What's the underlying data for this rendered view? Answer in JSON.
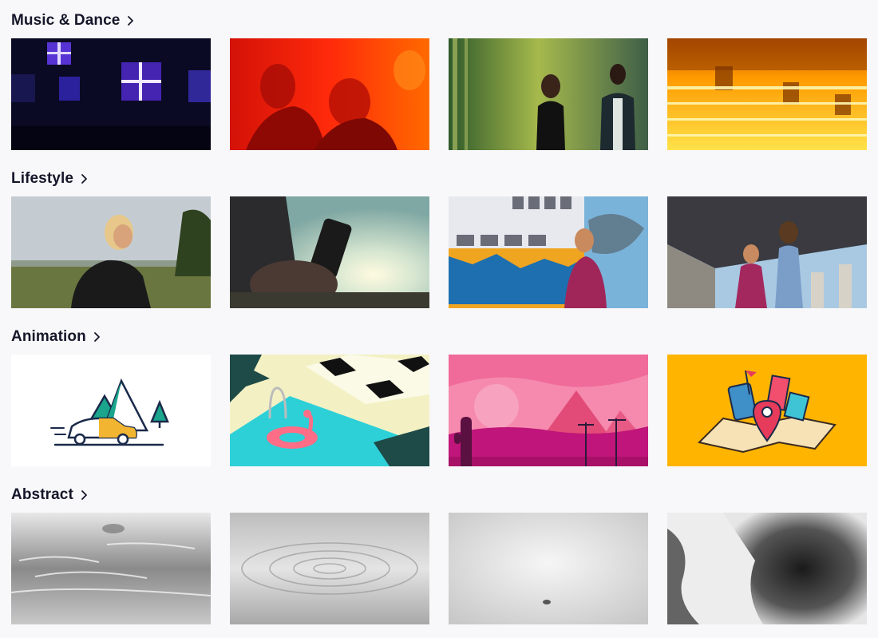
{
  "categories": [
    {
      "id": "music-dance",
      "title": "Music & Dance",
      "thumbnails": [
        {
          "name": "concert-lights-video",
          "palette": [
            "#0a0820",
            "#7a4cff"
          ]
        },
        {
          "name": "red-party-crowd-video",
          "palette": [
            "#e3190a",
            "#ff7a00"
          ]
        },
        {
          "name": "green-couple-dancing-video",
          "palette": [
            "#3a6a2e",
            "#b9c94a"
          ]
        },
        {
          "name": "stage-bulbs-video",
          "palette": [
            "#ff8a00",
            "#ffd200"
          ]
        }
      ]
    },
    {
      "id": "lifestyle",
      "title": "Lifestyle",
      "thumbnails": [
        {
          "name": "woman-phone-hillside-video",
          "palette": [
            "#b9c3c9",
            "#5b6a3a"
          ]
        },
        {
          "name": "phone-sunset-silhouette-video",
          "palette": [
            "#9ec3c3",
            "#3a3a3a"
          ]
        },
        {
          "name": "graffiti-wall-woman-video",
          "palette": [
            "#e9e9ee",
            "#f0a520"
          ]
        },
        {
          "name": "couple-under-bridge-video",
          "palette": [
            "#3a3a40",
            "#a7c9e6"
          ]
        }
      ]
    },
    {
      "id": "animation",
      "title": "Animation",
      "thumbnails": [
        {
          "name": "car-mountain-illustration",
          "palette": [
            "#ffffff",
            "#1aa58c"
          ]
        },
        {
          "name": "pool-flamingo-illustration",
          "palette": [
            "#2ad0d8",
            "#f1f0c3"
          ]
        },
        {
          "name": "pink-desert-illustration",
          "palette": [
            "#f06aa0",
            "#c0157a"
          ]
        },
        {
          "name": "travel-map-illustration",
          "palette": [
            "#ffb400",
            "#e63b5a"
          ]
        }
      ]
    },
    {
      "id": "abstract",
      "title": "Abstract",
      "thumbnails": [
        {
          "name": "water-splash-video",
          "palette": [
            "#b0b0b0",
            "#707070"
          ]
        },
        {
          "name": "water-ripple-video",
          "palette": [
            "#d8d8d8",
            "#a5a5a5"
          ]
        },
        {
          "name": "white-fog-video",
          "palette": [
            "#efefef",
            "#bdbdbd"
          ]
        },
        {
          "name": "ink-smoke-video",
          "palette": [
            "#f0f0f0",
            "#1a1a1a"
          ]
        }
      ]
    }
  ]
}
